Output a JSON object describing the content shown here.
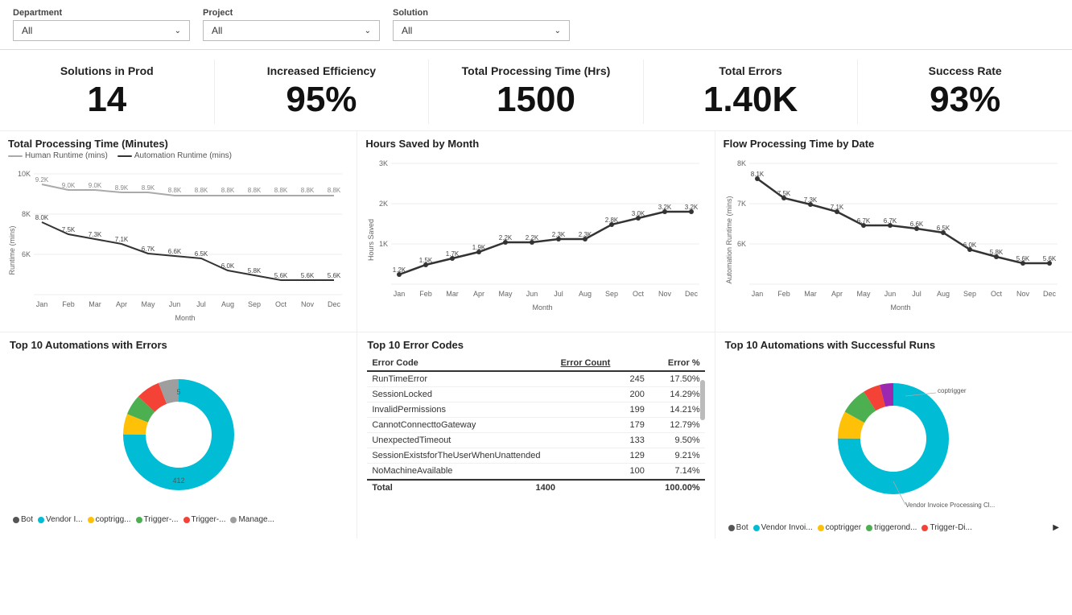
{
  "filters": {
    "department": {
      "label": "Department",
      "value": "All"
    },
    "project": {
      "label": "Project",
      "value": "All"
    },
    "solution": {
      "label": "Solution",
      "value": "All"
    }
  },
  "kpis": [
    {
      "title": "Solutions in Prod",
      "value": "14"
    },
    {
      "title": "Increased Efficiency",
      "value": "95%"
    },
    {
      "title": "Total Processing Time (Hrs)",
      "value": "1500"
    },
    {
      "title": "Total Errors",
      "value": "1.40K"
    },
    {
      "title": "Success Rate",
      "value": "93%"
    }
  ],
  "charts": {
    "total_processing": {
      "title": "Total Processing Time (Minutes)",
      "legend": [
        "Human Runtime (mins)",
        "Automation Runtime (mins)"
      ],
      "months": [
        "Jan",
        "Feb",
        "Mar",
        "Apr",
        "May",
        "Jun",
        "Jul",
        "Aug",
        "Sep",
        "Oct",
        "Nov",
        "Dec"
      ],
      "human": [
        9200,
        9000,
        9000,
        8900,
        8900,
        8800,
        8800,
        8800,
        8800,
        8800,
        8800,
        8800
      ],
      "automation": [
        8000,
        7500,
        7300,
        7100,
        6700,
        6600,
        6500,
        6000,
        5800,
        5600,
        5600,
        5600
      ]
    },
    "hours_saved": {
      "title": "Hours Saved by Month",
      "months": [
        "Jan",
        "Feb",
        "Mar",
        "Apr",
        "May",
        "Jun",
        "Jul",
        "Aug",
        "Sep",
        "Oct",
        "Nov",
        "Dec"
      ],
      "values": [
        1200,
        1500,
        1700,
        1900,
        2200,
        2200,
        2300,
        2300,
        2800,
        3000,
        3200,
        3200
      ]
    },
    "flow_processing": {
      "title": "Flow Processing Time by Date",
      "months": [
        "Jan",
        "Feb",
        "Mar",
        "Apr",
        "May",
        "Jun",
        "Jul",
        "Aug",
        "Sep",
        "Oct",
        "Nov",
        "Dec"
      ],
      "values": [
        8100,
        7500,
        7300,
        7100,
        6700,
        6700,
        6600,
        6500,
        6000,
        5800,
        5600,
        5600
      ]
    }
  },
  "bottom": {
    "errors_chart": {
      "title": "Top 10 Automations with Errors",
      "center_label": "412",
      "top_label": "5",
      "legend": [
        {
          "label": "Vendor I...",
          "color": "#00bcd4"
        },
        {
          "label": "coptrigg...",
          "color": "#ffc107"
        },
        {
          "label": "Trigger-...",
          "color": "#4caf50"
        },
        {
          "label": "Trigger-...",
          "color": "#f44336"
        },
        {
          "label": "Manage...",
          "color": "#9e9e9e"
        }
      ],
      "segments": [
        {
          "pct": 75,
          "color": "#00bcd4"
        },
        {
          "pct": 6,
          "color": "#ffc107"
        },
        {
          "pct": 6,
          "color": "#4caf50"
        },
        {
          "pct": 7,
          "color": "#f44336"
        },
        {
          "pct": 6,
          "color": "#9e9e9e"
        }
      ]
    },
    "error_codes": {
      "title": "Top 10 Error Codes",
      "columns": [
        "Error Code",
        "Error Count",
        "Error %"
      ],
      "rows": [
        [
          "RunTimeError",
          "245",
          "17.50%"
        ],
        [
          "SessionLocked",
          "200",
          "14.29%"
        ],
        [
          "InvalidPermissions",
          "199",
          "14.21%"
        ],
        [
          "CannotConnecttoGateway",
          "179",
          "12.79%"
        ],
        [
          "UnexpectedTimeout",
          "133",
          "9.50%"
        ],
        [
          "SessionExistsforTheUserWhenUnattended",
          "129",
          "9.21%"
        ],
        [
          "NoMachineAvailable",
          "100",
          "7.14%"
        ]
      ],
      "total_row": [
        "Total",
        "1400",
        "100.00%"
      ]
    },
    "success_chart": {
      "title": "Top 10 Automations with Successful Runs",
      "top_label": "coptrigger",
      "bottom_label": "Vendor Invoice Processing Cl...",
      "legend": [
        {
          "label": "Vendor Invoi...",
          "color": "#00bcd4"
        },
        {
          "label": "coptrigger",
          "color": "#ffc107"
        },
        {
          "label": "triggerond...",
          "color": "#4caf50"
        },
        {
          "label": "Trigger-Di...",
          "color": "#f44336"
        }
      ],
      "segments": [
        {
          "pct": 75,
          "color": "#00bcd4"
        },
        {
          "pct": 8,
          "color": "#ffc107"
        },
        {
          "pct": 8,
          "color": "#4caf50"
        },
        {
          "pct": 5,
          "color": "#f44336"
        },
        {
          "pct": 4,
          "color": "#9c27b0"
        }
      ]
    }
  }
}
